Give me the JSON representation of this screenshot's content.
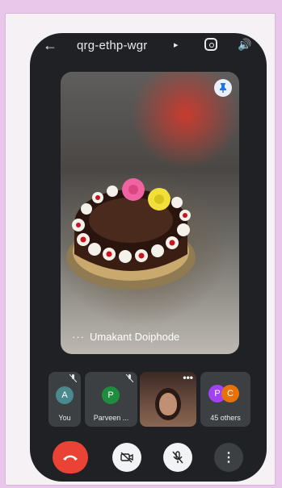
{
  "meeting": {
    "code": "qrg-ethp-wgr",
    "chevron": "▸"
  },
  "icons": {
    "back": "arrow-left-icon",
    "switch_camera": "switch-camera-icon",
    "speaker": "speaker-icon",
    "pin": "pin-icon"
  },
  "main_video": {
    "participant_name": "Umakant Doiphode",
    "menu_dots": "···"
  },
  "participants": [
    {
      "initial": "A",
      "label": "You",
      "avatar_color": "#4a8a8f",
      "muted": true
    },
    {
      "initial": "P",
      "label": "Parveen ...",
      "avatar_color": "#1e8e3e",
      "muted": true
    },
    {
      "label": "",
      "camera_on": true,
      "menu_dots": "•••"
    },
    {
      "initials": [
        "P",
        "C"
      ],
      "label": "45 others",
      "avatar_colors": [
        "#a142f4",
        "#e8710a"
      ]
    }
  ],
  "controls": {
    "end_call": "end-call-icon",
    "camera_off": "camera-off-icon",
    "mic_off": "mic-off-icon",
    "more": "⋮"
  },
  "colors": {
    "end_call": "#ea4335",
    "pin_bg": "#e8f0fe",
    "pin_fg": "#1a73e8",
    "phone_bg": "#202124",
    "tile_bg": "#3c4043"
  }
}
